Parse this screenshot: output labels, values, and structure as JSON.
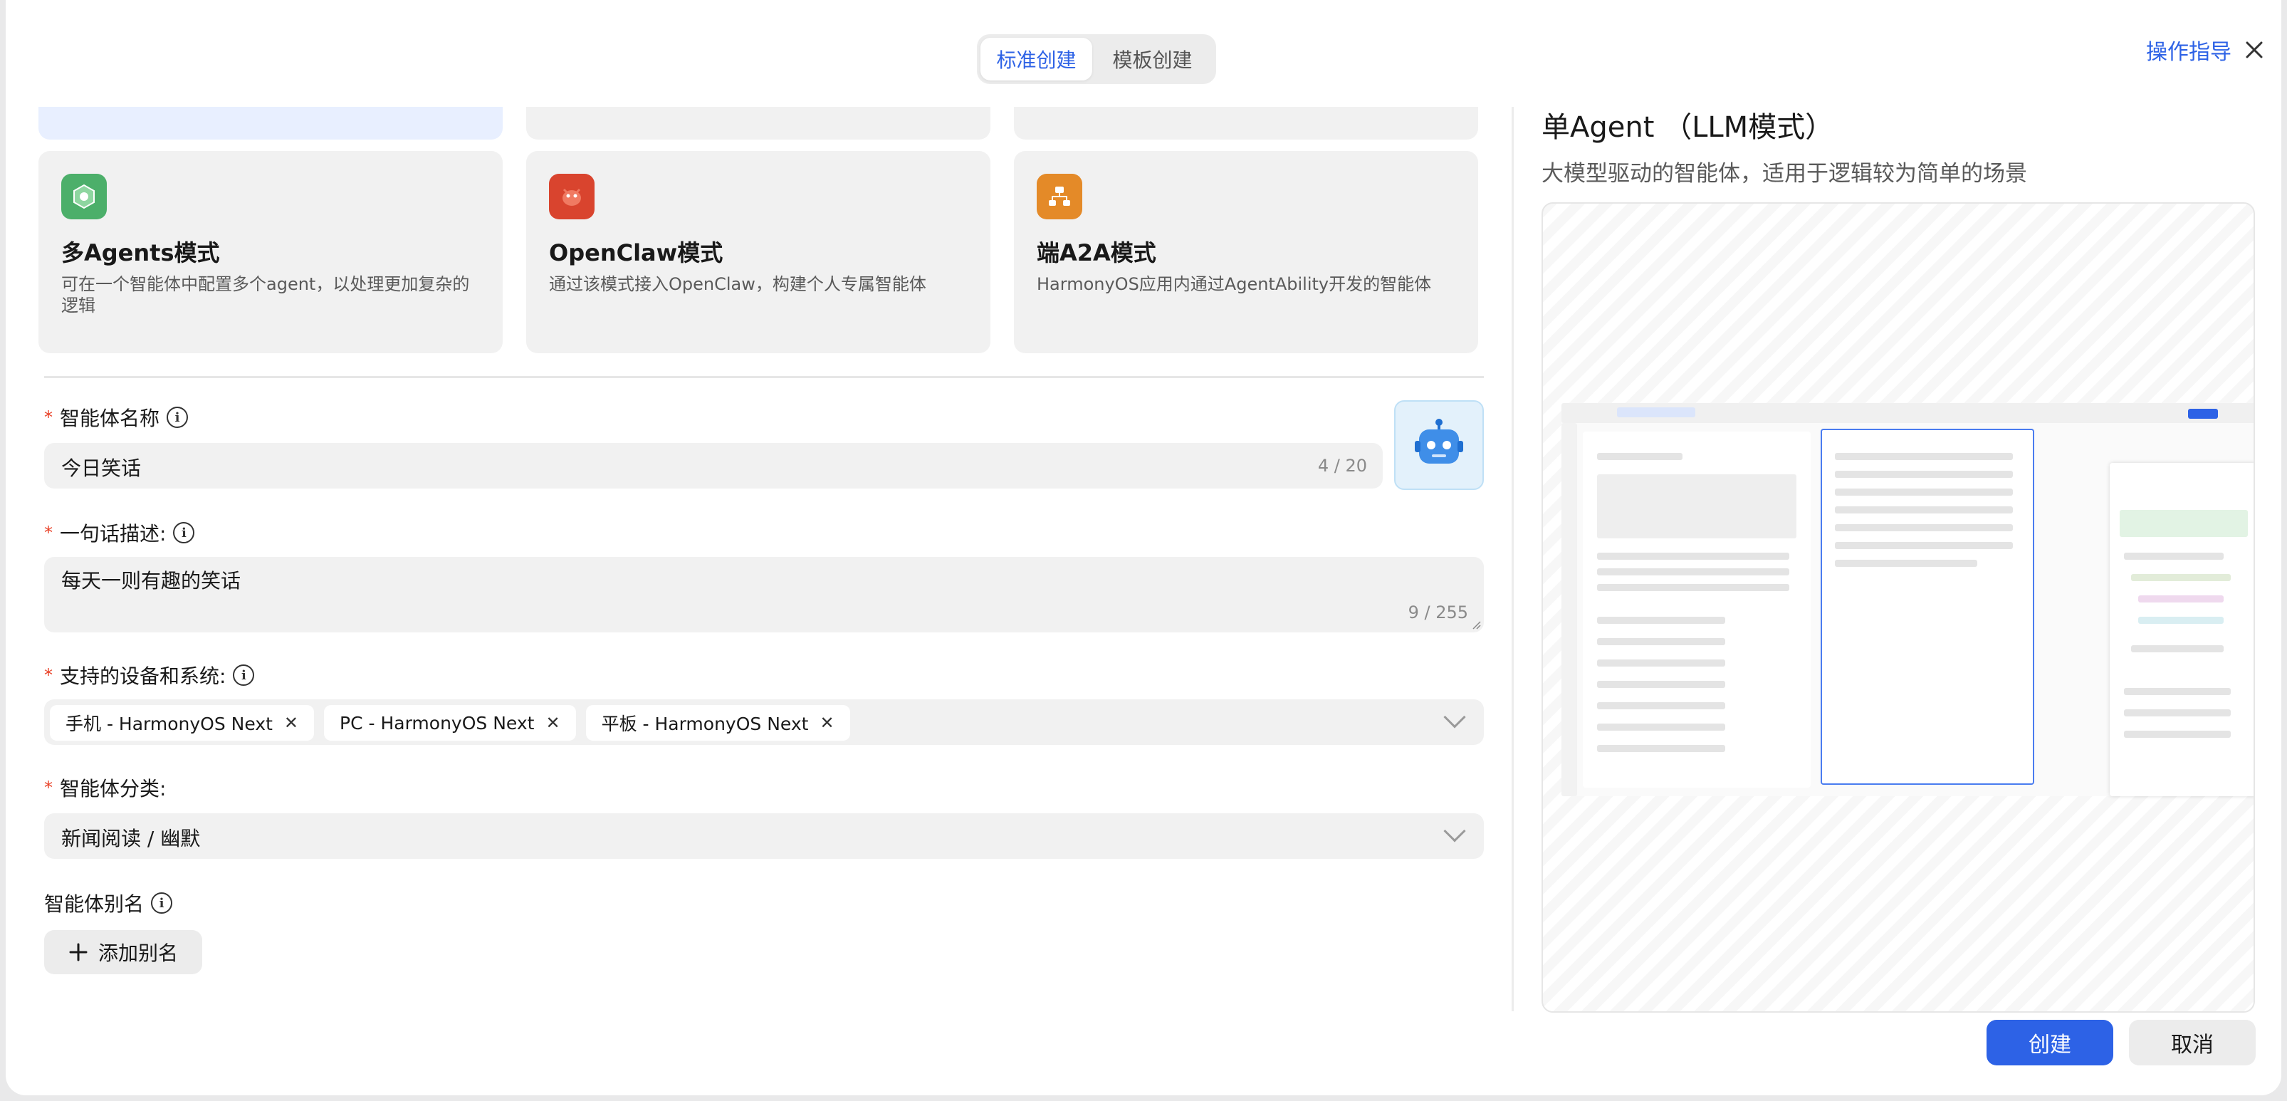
{
  "header": {
    "tabs": [
      {
        "label": "标准创建",
        "active": true
      },
      {
        "label": "模板创建",
        "active": false
      }
    ],
    "guide_link": "操作指导"
  },
  "modes": [
    {
      "title": "多Agents模式",
      "desc": "可在一个智能体中配置多个agent，以处理更加复杂的逻辑",
      "icon": "multi-agent-icon",
      "color": "#4caf6a"
    },
    {
      "title": "OpenClaw模式",
      "desc": "通过该模式接入OpenClaw，构建个人专属智能体",
      "icon": "openclaw-icon",
      "color": "#d9442e"
    },
    {
      "title": "端A2A模式",
      "desc": "HarmonyOS应用内通过AgentAbility开发的智能体",
      "icon": "a2a-icon",
      "color": "#e48a28"
    }
  ],
  "form": {
    "name": {
      "label": "智能体名称",
      "value": "今日笑话",
      "count": "4 / 20"
    },
    "desc": {
      "label": "一句话描述:",
      "value": "每天一则有趣的笑话",
      "count": "9 / 255"
    },
    "devices": {
      "label": "支持的设备和系统:",
      "tags": [
        "手机 - HarmonyOS Next",
        "PC - HarmonyOS Next",
        "平板 - HarmonyOS Next"
      ]
    },
    "category": {
      "label": "智能体分类:",
      "value": "新闻阅读 / 幽默"
    },
    "alias": {
      "label": "智能体别名",
      "add_button": "添加别名"
    }
  },
  "preview": {
    "title": "单Agent （LLM模式）",
    "desc": "大模型驱动的智能体，适用于逻辑较为简单的场景"
  },
  "footer": {
    "create": "创建",
    "cancel": "取消"
  },
  "colors": {
    "accent": "#2d62e6",
    "required": "#e84026"
  }
}
